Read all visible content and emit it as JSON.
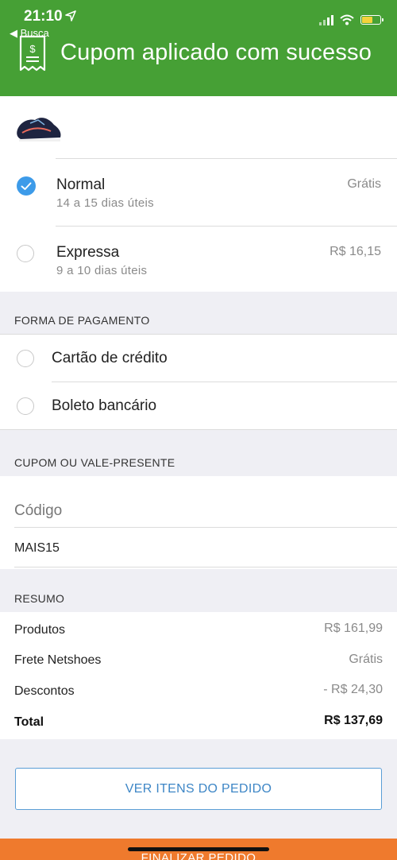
{
  "status": {
    "time": "21:10",
    "back": "◀ Busca"
  },
  "header": {
    "title": "Cupom aplicado com sucesso"
  },
  "shipping": [
    {
      "name": "Normal",
      "days": "14 a 15 dias úteis",
      "price": "Grátis",
      "selected": true
    },
    {
      "name": "Expressa",
      "days": "9 a 10 dias úteis",
      "price": "R$ 16,15",
      "selected": false
    }
  ],
  "payment": {
    "section_title": "FORMA DE PAGAMENTO",
    "options": [
      "Cartão de crédito",
      "Boleto bancário"
    ]
  },
  "coupon": {
    "section_title": "CUPOM OU VALE-PRESENTE",
    "placeholder": "Código",
    "value": "MAIS15"
  },
  "summary": {
    "section_title": "RESUMO",
    "rows": [
      {
        "label": "Produtos",
        "value": "R$ 161,99"
      },
      {
        "label": "Frete Netshoes",
        "value": "Grátis"
      },
      {
        "label": "Descontos",
        "value": "- R$ 24,30"
      }
    ],
    "total_label": "Total",
    "total_value": "R$ 137,69"
  },
  "buttons": {
    "view_items": "VER ITENS DO PEDIDO",
    "finish": "FINALIZAR PEDIDO"
  },
  "colors": {
    "header": "#46a035",
    "accent": "#3d9be9",
    "finish": "#ef7a2d"
  }
}
